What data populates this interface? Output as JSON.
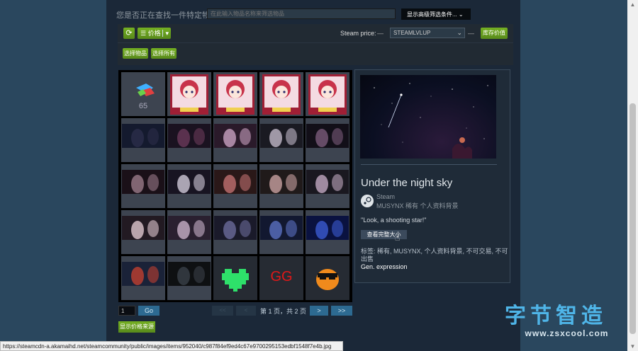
{
  "search": {
    "label": "您是否正在查找一件特定物品?",
    "placeholder": "在此输入物品名称来筛选物品",
    "advanced_button": "显示高级筛选条件..."
  },
  "toolbar": {
    "refresh_icon": "refresh-icon",
    "price_label": "价格",
    "steam_price_label": "Steam price:",
    "dash": "—",
    "steam_select_value": "STEAMLVLUP",
    "inventory_value_button": "库存价值",
    "select_items_button": "选择物品",
    "select_all_button": "选择所有"
  },
  "grid": {
    "first_item_count": "65",
    "cells": [
      {
        "kind": "gems"
      },
      {
        "kind": "card"
      },
      {
        "kind": "card"
      },
      {
        "kind": "card"
      },
      {
        "kind": "card"
      },
      {
        "kind": "background"
      },
      {
        "kind": "background"
      },
      {
        "kind": "background"
      },
      {
        "kind": "background"
      },
      {
        "kind": "background"
      },
      {
        "kind": "background"
      },
      {
        "kind": "background"
      },
      {
        "kind": "background"
      },
      {
        "kind": "background"
      },
      {
        "kind": "background"
      },
      {
        "kind": "background"
      },
      {
        "kind": "background"
      },
      {
        "kind": "background"
      },
      {
        "kind": "background"
      },
      {
        "kind": "background"
      },
      {
        "kind": "background"
      },
      {
        "kind": "background"
      },
      {
        "kind": "emoticon-heart"
      },
      {
        "kind": "emoticon-gg"
      },
      {
        "kind": "emoticon-cool"
      }
    ],
    "gg_text": "GG"
  },
  "detail": {
    "title": "Under the night sky",
    "game": "Steam",
    "type": "MUSYNX 稀有 个人资料背景",
    "description": "\"Look, a shooting star!\"",
    "view_full_button": "查看完整大小",
    "tags": "标签: 稀有, MUSYNX, 个人资料背景, 不可交易, 不可出售",
    "gen_expression": "Gen. expression"
  },
  "pager": {
    "page_input_value": "1",
    "go_button": "Go",
    "first_button": "<<",
    "prev_button": "<",
    "page_text": "第 1 页，共 2 页",
    "next_button": ">",
    "last_button": ">>"
  },
  "show_price_source_button": "显示价格来源",
  "status_url": "https://steamcdn-a.akamaihd.net/steamcommunity/public/images/items/952040/c987f84ef9ed4c67e9700295153edbf1548f7e4b.jpg",
  "watermark": {
    "title": "字节智造",
    "url": "www.zsxcool.com"
  },
  "colors": {
    "page_bg": "#1b2838",
    "accent_green": "#75b022",
    "accent_blue": "#2d6a91"
  }
}
